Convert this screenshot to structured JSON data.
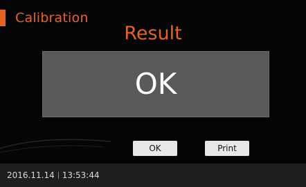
{
  "header": {
    "title": "Calibration"
  },
  "result": {
    "heading": "Result",
    "value": "OK"
  },
  "actions": {
    "ok_label": "OK",
    "print_label": "Print"
  },
  "status": {
    "date": "2016.11.14",
    "time": "13:53:44"
  },
  "colors": {
    "accent": "#e8641e",
    "panel": "#595959",
    "background": "#050505",
    "status_bar": "#1e1e1e"
  }
}
